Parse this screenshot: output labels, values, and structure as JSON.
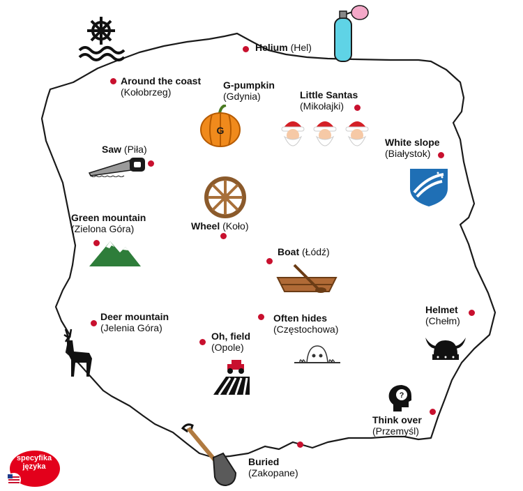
{
  "map": {
    "places": [
      {
        "english": "Helium",
        "polish": "Hel",
        "icon": "helium-tank-icon"
      },
      {
        "english": "Around the coast",
        "polish": "Kołobrzeg",
        "icon": "ship-wheel-waves-icon"
      },
      {
        "english": "G-pumpkin",
        "polish": "Gdynia",
        "icon": "pumpkin-icon"
      },
      {
        "english": "Little Santas",
        "polish": "Mikołajki",
        "icon": "santa-faces-icon"
      },
      {
        "english": "White slope",
        "polish": "Białystok",
        "icon": "ski-slope-shield-icon"
      },
      {
        "english": "Saw",
        "polish": "Piła",
        "icon": "hand-saw-icon"
      },
      {
        "english": "Wheel",
        "polish": "Koło",
        "icon": "wooden-wheel-icon"
      },
      {
        "english": "Green mountain",
        "polish": "Zielona Góra",
        "icon": "green-mountain-icon"
      },
      {
        "english": "Boat",
        "polish": "Łódź",
        "icon": "rowing-boat-icon"
      },
      {
        "english": "Deer mountain",
        "polish": "Jelenia Góra",
        "icon": "deer-icon"
      },
      {
        "english": "Often hides",
        "polish": "Częstochowa",
        "icon": "peeking-face-icon"
      },
      {
        "english": "Helmet",
        "polish": "Chełm",
        "icon": "viking-helmet-icon"
      },
      {
        "english": "Oh, field",
        "polish": "Opole",
        "icon": "tractor-field-icon"
      },
      {
        "english": "Think over",
        "polish": "Przemyśl",
        "icon": "thinking-head-icon"
      },
      {
        "english": "Buried",
        "polish": "Zakopane",
        "icon": "shovel-icon"
      }
    ],
    "colors": {
      "dot": "#c8102e",
      "outline": "#1a1a1a",
      "badge": "#e3001b"
    }
  },
  "brand": {
    "line1": "specyfika",
    "line2": "języka"
  }
}
